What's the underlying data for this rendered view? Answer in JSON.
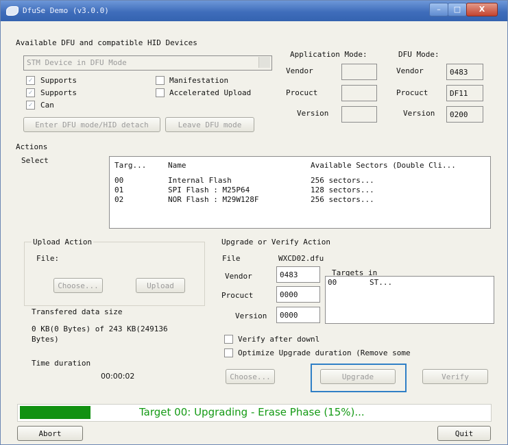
{
  "window": {
    "title": "DfuSe Demo (v3.0.0)",
    "accent": "#3f6dbb",
    "progress_color": "#119111"
  },
  "devices": {
    "heading": "Available DFU and compatible HID Devices",
    "selected_device": "STM Device in DFU Mode",
    "checks": {
      "supports1": "Supports",
      "supports2": "Supports",
      "can": "Can",
      "manifestation": "Manifestation",
      "accelerated_upload": "Accelerated Upload"
    },
    "enter_dfu_button": "Enter DFU mode/HID detach",
    "leave_dfu_button": "Leave DFU mode"
  },
  "app_mode": {
    "heading": "Application Mode:",
    "vendor_label": "Vendor",
    "procuct_label": "Procuct",
    "version_label": "Version",
    "vendor": "",
    "procuct": "",
    "version": ""
  },
  "dfu_mode": {
    "heading": "DFU Mode:",
    "vendor_label": "Vendor",
    "procuct_label": "Procuct",
    "version_label": "Version",
    "vendor": "0483",
    "procuct": "DF11",
    "version": "0200"
  },
  "actions": {
    "heading": "Actions",
    "select_label": "Select",
    "columns": [
      "Targ...",
      "Name",
      "Available Sectors (Double Cli..."
    ],
    "rows": [
      {
        "target": "00",
        "name": "Internal Flash",
        "sectors": "256 sectors..."
      },
      {
        "target": "01",
        "name": "SPI Flash : M25P64",
        "sectors": "128 sectors..."
      },
      {
        "target": "02",
        "name": "NOR Flash : M29W128F",
        "sectors": "256 sectors..."
      }
    ]
  },
  "upload": {
    "heading": "Upload Action",
    "file_label": "File:",
    "choose_button": "Choose...",
    "upload_button": "Upload",
    "transfered_heading": "Transfered data size",
    "transfered_line1": "0 KB(0 Bytes) of 243 KB(249136",
    "transfered_line2": "Bytes)",
    "time_heading": "Time duration",
    "time_value": "00:00:02"
  },
  "upgrade": {
    "heading": "Upgrade or Verify Action",
    "file_label": "File",
    "file_value": "WXCD02.dfu",
    "vendor_label": "Vendor",
    "procuct_label": "Procuct",
    "version_label": "Version",
    "vendor": "0483",
    "procuct": "0000",
    "version": "0000",
    "targets_label": "Targets in",
    "targets": [
      {
        "id": "00",
        "name": "ST..."
      }
    ],
    "verify_after_download": "Verify after downl",
    "optimize_upgrade": "Optimize Upgrade duration (Remove some",
    "choose_button": "Choose...",
    "upgrade_button": "Upgrade",
    "verify_button": "Verify"
  },
  "status": {
    "text": "Target 00: Upgrading - Erase Phase (15%)...",
    "progress": 0.15
  },
  "bottom": {
    "abort_button": "Abort",
    "quit_button": "Quit"
  }
}
